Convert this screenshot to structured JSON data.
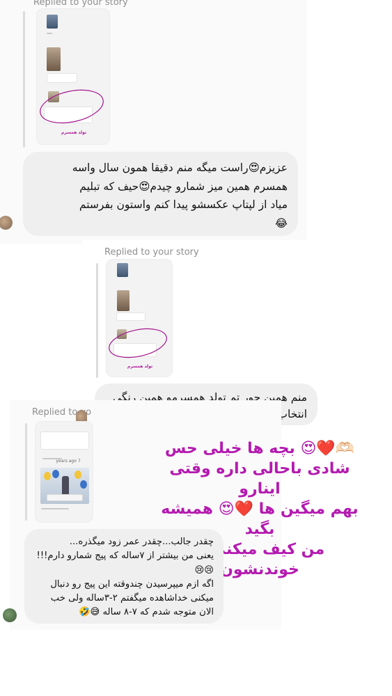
{
  "reply_label_1": "Replied to your story",
  "reply_label_2": "Replied to your story",
  "reply_label_3": "Replied to yo",
  "message_1": "عزیزم😍راست میگه منم دقیقا همون سال واسه\nهمسرم همین میز شمارو چیدم😍حیف که تبلیم\nمیاد از لپتاپ عکسشو پیدا کنم واستون بفرستم\n😂",
  "message_2": "منم همین جور تم تولد همسرمو همین رنگی\nانتخاب کردم و کلی ایده ازت گرفتم",
  "message_3": "چقدر جالب...چقدر عمر زود میگذره...\nیعنی من بیشتر از ۷ساله که پیج شمارو دارم!!!\n😢😢\nاگه ازم میپرسیدن چندوقته این پیج رو دنبال\nمیکنی خداشاهده میگفتم ۲-۳ساله ولی خب\nالان متوجه شدم که ۷-۸ ساله 😅🤣",
  "overlay_caption": "🫶🏻❤️😍 بچه ها خیلی حس\nشادی باحالی داره وقتی اینارو\nبهم میگین ها ❤️😍 همیشه بگید\nمن کیف میکنم از خوندنشون",
  "mini_caption_1": "تولد همسرم",
  "mini_caption_2": "تولد همسرم",
  "mini_years_ago": "7 years ago",
  "colors": {
    "bubble": "#efefef",
    "overlay_text": "#b41ab0",
    "label": "#8e8e8e"
  }
}
